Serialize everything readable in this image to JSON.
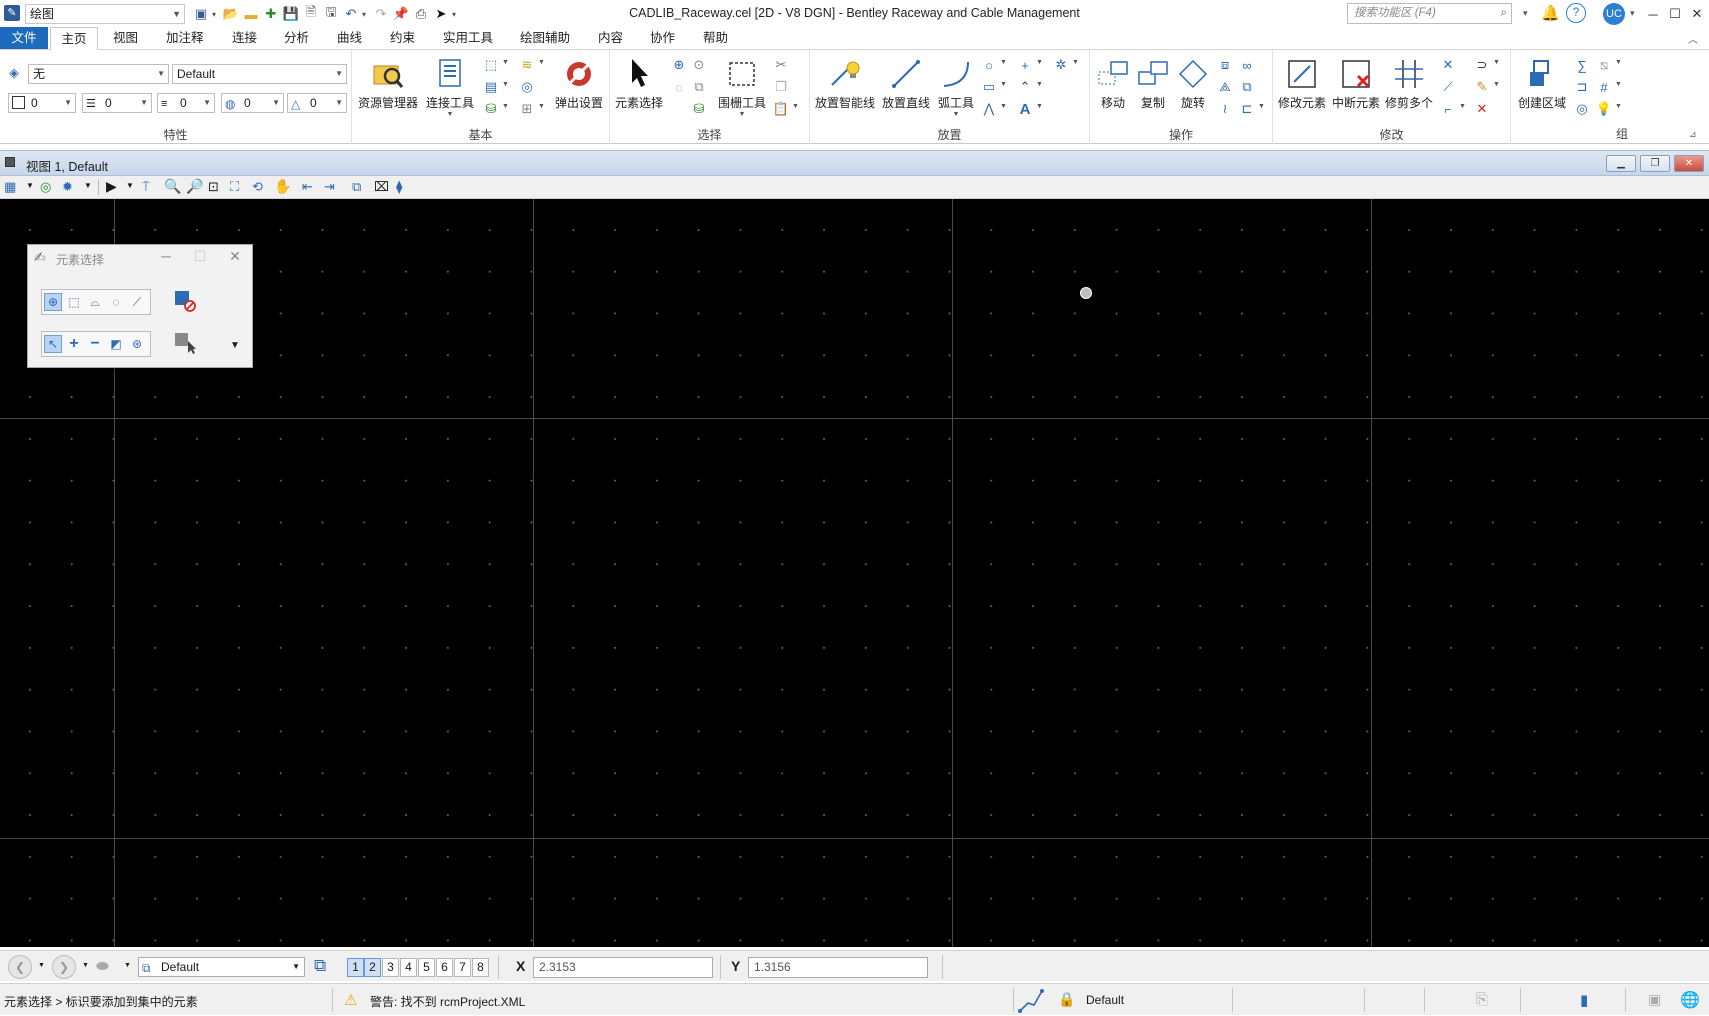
{
  "titlebar": {
    "workspace": "绘图",
    "title": "CADLIB_Raceway.cel [2D - V8 DGN] - Bentley Raceway and Cable Management",
    "search_placeholder": "搜索功能区 (F4)",
    "user": "UC"
  },
  "menu": [
    "文件",
    "主页",
    "视图",
    "加注释",
    "连接",
    "分析",
    "曲线",
    "约束",
    "实用工具",
    "绘图辅助",
    "内容",
    "协作",
    "帮助"
  ],
  "ribbon": {
    "attributes": {
      "level": "无",
      "style": "Default",
      "color": "0",
      "weight": "0",
      "linestyle": "0",
      "transparency": "0",
      "priority": "0",
      "label": "特性"
    },
    "basic": {
      "label": "基本",
      "explorer": "资源管理器",
      "connect": "连接工具",
      "popup": "弹出设置"
    },
    "select": {
      "label": "选择",
      "element_select": "元素选择",
      "fence": "围栅工具"
    },
    "placement": {
      "label": "放置",
      "smartline": "放置智能线",
      "line": "放置直线",
      "arc": "弧工具"
    },
    "manipulate": {
      "label": "操作",
      "move": "移动",
      "copy": "复制",
      "rotate": "旋转"
    },
    "modify": {
      "label": "修改",
      "modify_element": "修改元素",
      "break": "中断元素",
      "trim": "修剪多个"
    },
    "groups": {
      "label": "组",
      "create_region": "创建区域"
    }
  },
  "view": {
    "title": "视图 1, Default"
  },
  "palette": {
    "title": "元素选择"
  },
  "statusbar": {
    "view_combo": "Default",
    "view_numbers": [
      "1",
      "2",
      "3",
      "4",
      "5",
      "6",
      "7",
      "8"
    ],
    "x_label": "X",
    "x_value": "2.3153",
    "y_label": "Y",
    "y_value": "1.3156",
    "prompt": "元素选择 > 标识要添加到集中的元素",
    "warning": "警告: 找不到 rcmProject.XML",
    "model": "Default"
  }
}
